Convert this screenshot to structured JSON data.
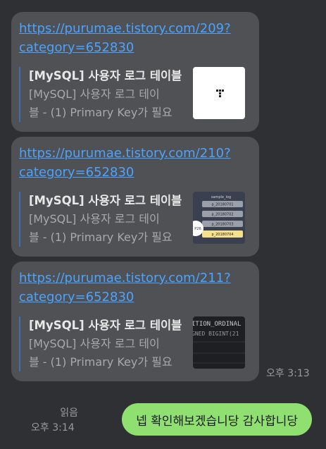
{
  "messages": [
    {
      "url": "https://purumae.tistory.com/209?category=652830",
      "url_line1": "https://purumae.tistory.com/209?",
      "url_line2": "category=652830",
      "title": "[MySQL] 사용자 로그 테이블",
      "desc_line1": "[MySQL] 사용자 로그 테이",
      "desc_line2": "블 - (1) Primary Key가 필요",
      "thumb": "blank-logo"
    },
    {
      "url": "https://purumae.tistory.com/210?category=652830",
      "url_line1": "https://purumae.tistory.com/210?",
      "url_line2": "category=652830",
      "title": "[MySQL] 사용자 로그 테이블",
      "desc_line1": "[MySQL] 사용자 로그 테이",
      "desc_line2": "블 - (1) Primary Key가 필요",
      "thumb": "diagram",
      "thumb_labels": [
        "sample_log",
        "p_20180701",
        "p_20180702",
        "p_20180703",
        "p_20180704",
        "P26"
      ]
    },
    {
      "url": "https://purumae.tistory.com/211?category=652830",
      "url_line1": "https://purumae.tistory.com/211?",
      "url_line2": "category=652830",
      "title": "[MySQL] 사용자 로그 테이블",
      "desc_line1": "[MySQL] 사용자 로그 테이",
      "desc_line2": "블 - (1) Primary Key가 필요",
      "thumb": "code",
      "thumb_labels": [
        "ITION_ORDINAL",
        "GNED BIGINT(21"
      ]
    }
  ],
  "received_time": "오후 3:13",
  "sent": {
    "read_label": "읽음",
    "time": "오후 3:14",
    "text": "넵 확인해보겠습니당 감사합니당"
  },
  "colors": {
    "background": "#2f3033",
    "bubble": "#505154",
    "link": "#4aa3ff",
    "my_bubble": "#8fe070"
  }
}
